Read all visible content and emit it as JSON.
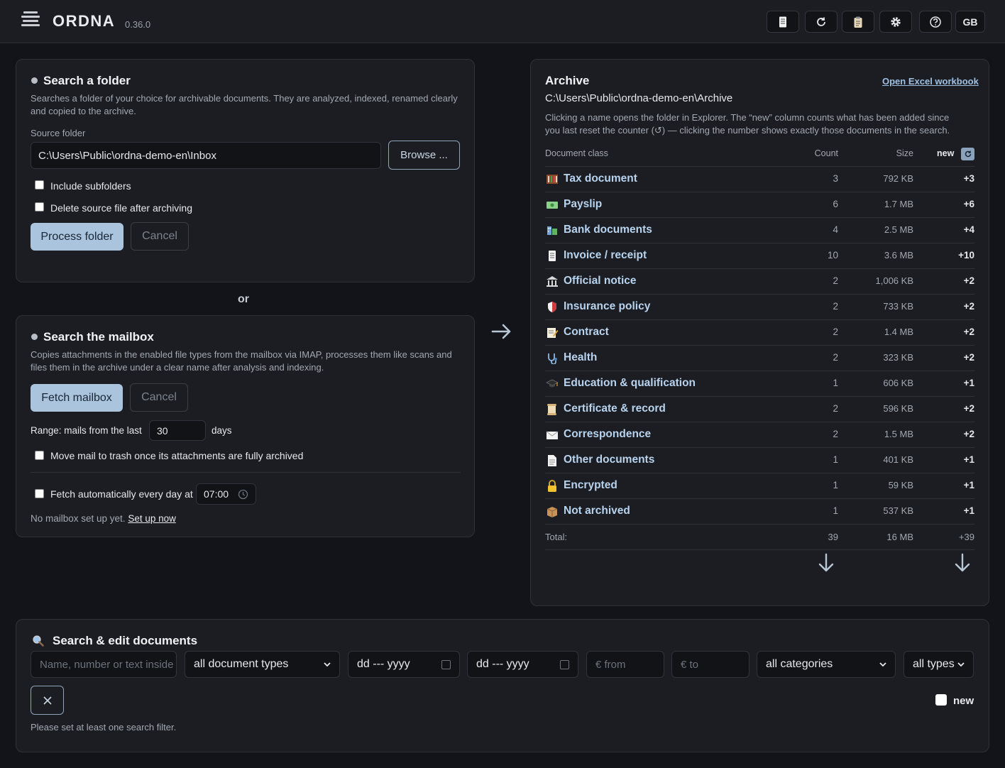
{
  "header": {
    "brand": "ORDNA",
    "version": "0.36.0",
    "buttons": [
      {
        "name": "archive-button",
        "icon": "document-icon"
      },
      {
        "name": "refresh-button",
        "icon": "refresh-icon"
      },
      {
        "name": "clipboard-button",
        "icon": "clipboard-icon"
      },
      {
        "name": "settings-button",
        "icon": "gear-icon"
      },
      {
        "name": "help-button",
        "icon": "help-icon"
      }
    ],
    "language": "GB"
  },
  "folder_card": {
    "title": "Search a folder",
    "description": "Searches a folder of your choice for archivable documents. They are analyzed, indexed, renamed clearly and copied to the archive.",
    "source_label": "Source folder",
    "source_value": "C:\\Users\\Public\\ordna-demo-en\\Inbox",
    "browse_label": "Browse ...",
    "include_subfolders": "Include subfolders",
    "delete_source": "Delete source file after archiving",
    "process_label": "Process folder",
    "cancel_label": "Cancel"
  },
  "or_label": "or",
  "mailbox_card": {
    "title": "Search the mailbox",
    "description": "Copies attachments in the enabled file types from the mailbox via IMAP, processes them like scans and files them in the archive under a clear name after analysis and indexing.",
    "fetch_label": "Fetch mailbox",
    "cancel_label": "Cancel",
    "range_prefix": "Range: mails from the last",
    "range_value": "30",
    "range_suffix": "days",
    "move_to_trash": "Move mail to trash once its attachments are fully archived",
    "auto_fetch": "Fetch automatically every day at",
    "auto_time": "07:00",
    "no_mailbox": "No mailbox set up yet.",
    "setup_link": "Set up now"
  },
  "archive": {
    "title": "Archive",
    "open_excel": "Open Excel workbook",
    "path": "C:\\Users\\Public\\ordna-demo-en\\Archive",
    "description_1": "Clicking a name opens the folder in Explorer. The “new” column counts what has been added since",
    "description_2": "you last reset the counter (↺) — clicking the number shows exactly those documents in the search.",
    "headers": {
      "class": "Document class",
      "count": "Count",
      "size": "Size",
      "new": "new"
    },
    "rows": [
      {
        "icon": "abacus-icon",
        "name": "Tax document",
        "count": "3",
        "size": "792 KB",
        "new": "+3"
      },
      {
        "icon": "money-icon",
        "name": "Payslip",
        "count": "6",
        "size": "1.7 MB",
        "new": "+6"
      },
      {
        "icon": "bank-icon",
        "name": "Bank documents",
        "count": "4",
        "size": "2.5 MB",
        "new": "+4"
      },
      {
        "icon": "receipt-icon",
        "name": "Invoice / receipt",
        "count": "10",
        "size": "3.6 MB",
        "new": "+10"
      },
      {
        "icon": "government-icon",
        "name": "Official notice",
        "count": "2",
        "size": "1,006 KB",
        "new": "+2"
      },
      {
        "icon": "shield-icon",
        "name": "Insurance policy",
        "count": "2",
        "size": "733 KB",
        "new": "+2"
      },
      {
        "icon": "memo-icon",
        "name": "Contract",
        "count": "2",
        "size": "1.4 MB",
        "new": "+2"
      },
      {
        "icon": "stethoscope-icon",
        "name": "Health",
        "count": "2",
        "size": "323 KB",
        "new": "+2"
      },
      {
        "icon": "graduation-cap-icon",
        "name": "Education & qualification",
        "count": "1",
        "size": "606 KB",
        "new": "+1"
      },
      {
        "icon": "scroll-icon",
        "name": "Certificate & record",
        "count": "2",
        "size": "596 KB",
        "new": "+2"
      },
      {
        "icon": "envelope-icon",
        "name": "Correspondence",
        "count": "2",
        "size": "1.5 MB",
        "new": "+2"
      },
      {
        "icon": "page-icon",
        "name": "Other documents",
        "count": "1",
        "size": "401 KB",
        "new": "+1"
      },
      {
        "icon": "lock-icon",
        "name": "Encrypted",
        "count": "1",
        "size": "59 KB",
        "new": "+1"
      },
      {
        "icon": "package-icon",
        "name": "Not archived",
        "count": "1",
        "size": "537 KB",
        "new": "+1"
      }
    ],
    "total": {
      "label": "Total:",
      "count": "39",
      "size": "16 MB",
      "new": "+39"
    }
  },
  "search": {
    "title": "Search & edit documents",
    "text_placeholder": "Name, number or text inside",
    "doc_types": "all document types",
    "date_from": "dd --- yyyy",
    "date_to": "dd --- yyyy",
    "amount_from": "€ from",
    "amount_to": "€ to",
    "categories": "all categories",
    "types": "all types",
    "new_label": "new",
    "hint": "Please set at least one search filter."
  },
  "colors": {
    "background": "#131419",
    "card": "#1b1d23",
    "accent": "#a9c4dc",
    "link": "#b8d3ee"
  }
}
